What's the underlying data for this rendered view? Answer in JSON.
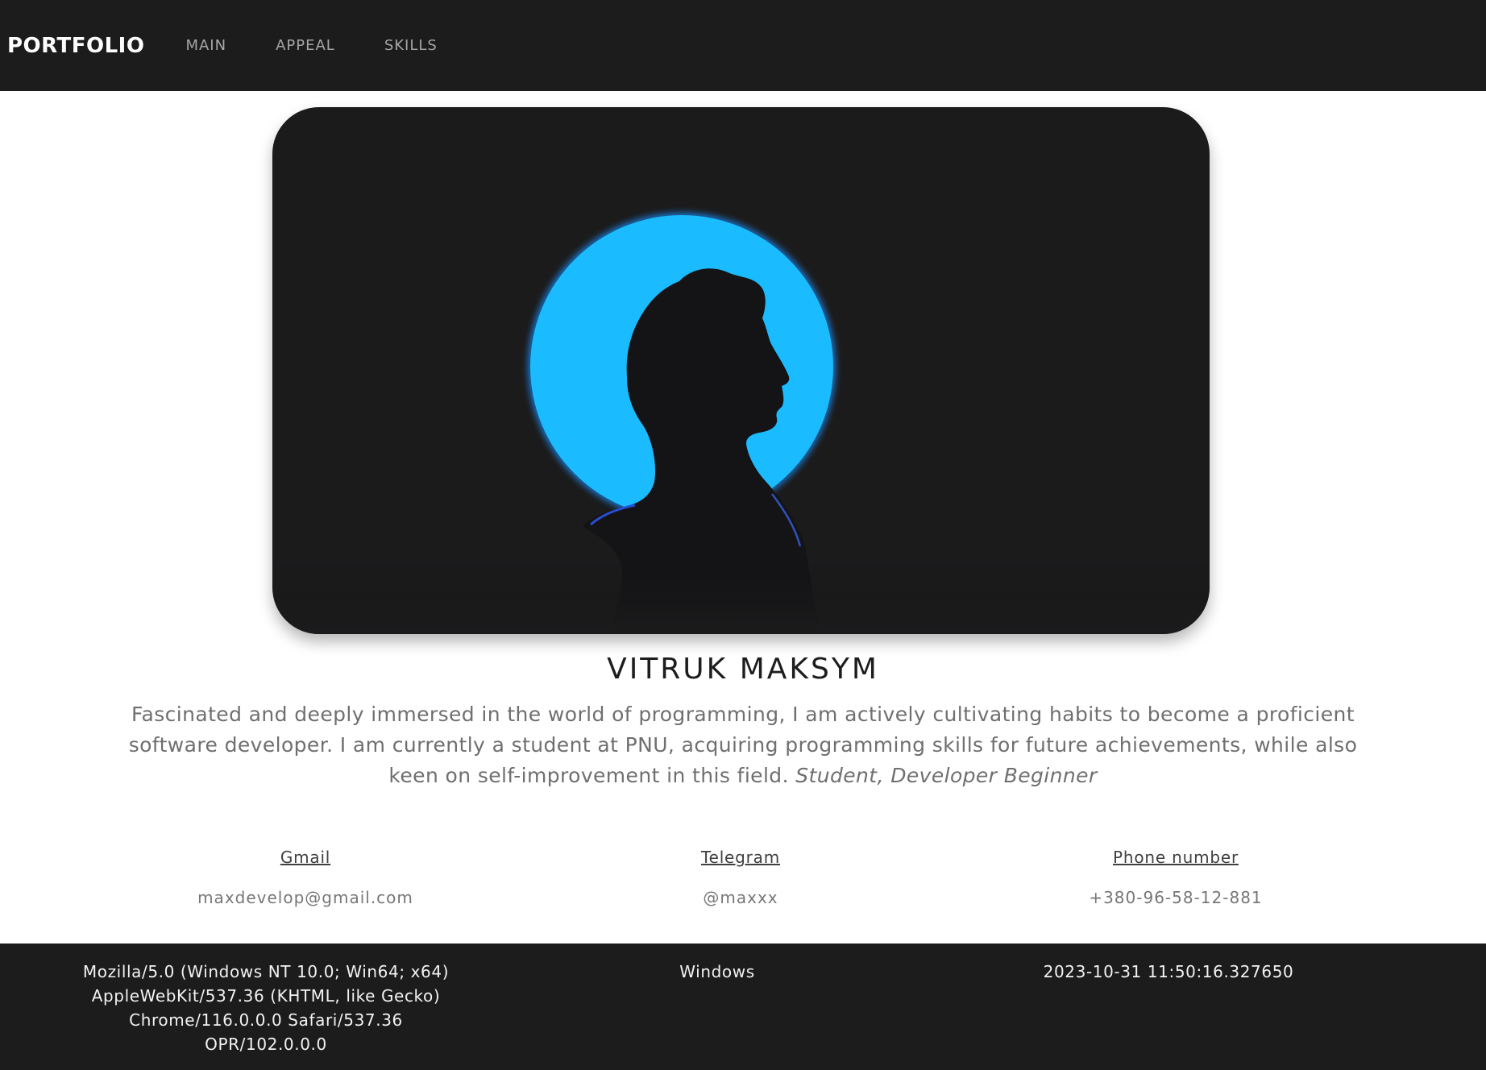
{
  "navbar": {
    "brand": "PORTFOLIO",
    "links": [
      "MAIN",
      "APPEAL",
      "SKILLS"
    ]
  },
  "hero": {
    "image": "silhouette-portrait",
    "colors": {
      "background": "#1b1b1c",
      "halo": "#1bbbff",
      "figure": "#141416"
    }
  },
  "profile": {
    "name": "VITRUK MAKSYM",
    "description": "Fascinated and deeply immersed in the world of programming, I am actively cultivating habits to become a proficient software developer. I am currently a student at PNU, acquiring programming skills for future achievements, while also keen on self-improvement in this field.",
    "tagline": "Student, Developer Beginner"
  },
  "contacts": [
    {
      "label": "Gmail",
      "value": "maxdevelop@gmail.com"
    },
    {
      "label": "Telegram",
      "value": "@maxxx"
    },
    {
      "label": "Phone number",
      "value": "+380-96-58-12-881"
    }
  ],
  "footer": {
    "user_agent": "Mozilla/5.0 (Windows NT 10.0; Win64; x64) AppleWebKit/537.36 (KHTML, like Gecko) Chrome/116.0.0.0 Safari/537.36 OPR/102.0.0.0",
    "os": "Windows",
    "datetime": "2023-10-31 11:50:16.327650"
  },
  "colors": {
    "navbar_bg": "#1c1c1d",
    "footer_bg": "#1c1c1d",
    "accent": "#1bbbff"
  }
}
